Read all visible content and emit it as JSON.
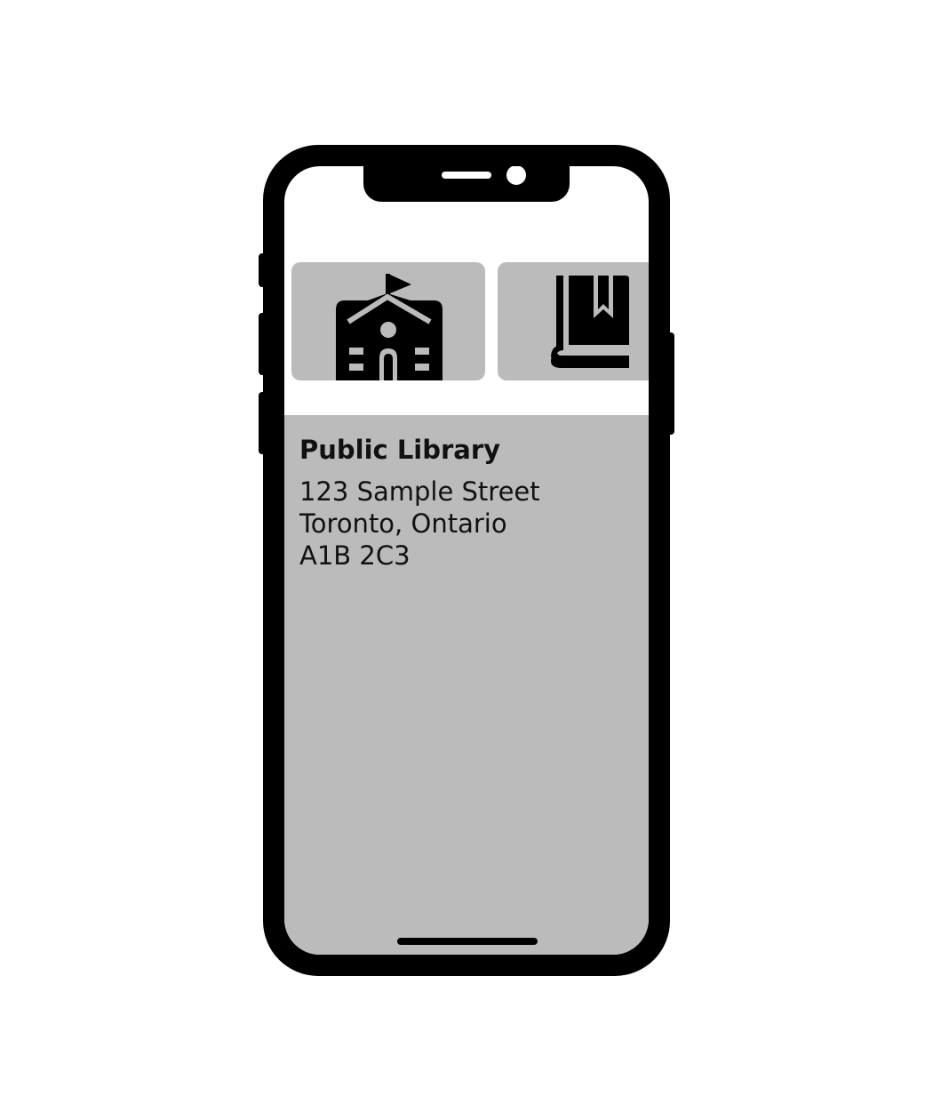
{
  "place": {
    "name": "Public Library",
    "address_line1": "123 Sample Street",
    "address_line2": "Toronto, Ontario",
    "address_line3": "A1B 2C3"
  },
  "carousel": {
    "tiles": [
      {
        "icon": "school-building-icon"
      },
      {
        "icon": "book-bookmark-icon"
      }
    ]
  },
  "colors": {
    "device": "#000000",
    "screen_background": "#ffffff",
    "panel_background": "#bbbbbb",
    "text": "#111111"
  }
}
